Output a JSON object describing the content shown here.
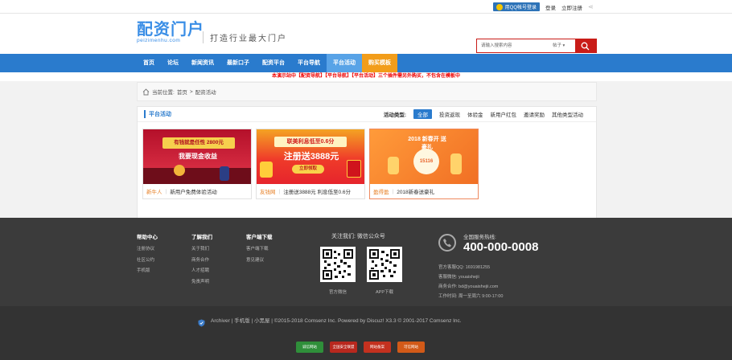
{
  "topbar": {
    "qq_login": "用QQ帐号登录",
    "login": "登录",
    "register": "立即注册"
  },
  "logo": {
    "cn": "配资门户",
    "en": "peizimenhu.com"
  },
  "slogan": "打造行业最大门户",
  "search": {
    "placeholder": "请输入搜索内容",
    "scope": "帖子 ▾"
  },
  "nav": [
    {
      "label": "首页"
    },
    {
      "label": "论坛"
    },
    {
      "label": "新闻资讯"
    },
    {
      "label": "最新口子"
    },
    {
      "label": "配资平台"
    },
    {
      "label": "平台导航"
    },
    {
      "label": "平台活动"
    },
    {
      "label": "购买模板"
    }
  ],
  "notice": "本演示站中【配资导航】【平台导航】【平台活动】三个插件需另外购买，不包含在模板中",
  "breadcrumb": {
    "prefix": "当前位置:",
    "home": "首页",
    "sep": ">",
    "current": "配资活动"
  },
  "panel": {
    "title": "平台活动",
    "filter_label": "活动类型:",
    "filters": [
      "全部",
      "投资返现",
      "体验金",
      "新用户红包",
      "邀请奖励",
      "其他类型活动"
    ]
  },
  "cards": [
    {
      "tag": "新牛人",
      "title": "新用户免费体验活动",
      "banner_line1": "有钱就是任性 2800元",
      "banner_line2": "我要现金收益",
      "color": "#c81b2f"
    },
    {
      "tag": "友钱网",
      "title": "注册送3888元 利息低至0.6分",
      "banner_line1": "联美利息低至0.6分",
      "banner_line2": "注册送3888元",
      "banner_button": "立即领取",
      "color": "#f2432c"
    },
    {
      "tag": "盈得盈",
      "title": "2018新春送豪礼",
      "banner_line1": "2018 新春开 送豪礼",
      "banner_line2": "15116",
      "color": "#f78a2b"
    }
  ],
  "footer": {
    "cols": [
      {
        "title": "帮助中心",
        "items": [
          "注册协议",
          "社区公约",
          "手机版"
        ]
      },
      {
        "title": "了解我们",
        "items": [
          "关于我们",
          "商务合作",
          "人才招聘",
          "免责声明"
        ]
      },
      {
        "title": "客户端下载",
        "items": [
          "客户端下载",
          "意见建议"
        ]
      }
    ],
    "follow": "关注我们:  微信公众号",
    "qr_labels": [
      "官方微信",
      "APP下载"
    ],
    "hotline_label": "全国服务热线:",
    "hotline": "400-000-0008",
    "contacts": [
      "官方客服QQ:  1691981255",
      "客服微信:  youaishejii",
      "商务合作:  bd@youaishejii.com",
      "工作时间:  周一至周六 9:00-17:00"
    ]
  },
  "bottom": {
    "copyright": "Archiver  |  手机版  |  小黑屋   |     ©2015-2018   Comsenz Inc.   Powered by Discuz!   X3.3 © 2001-2017 Comsenz Inc.",
    "badges": [
      "诚信网站",
      "全国安全联盟",
      "网站备案",
      "可信网站"
    ]
  },
  "colors": {
    "brand": "#2a7bcd",
    "search": "#c91c18",
    "accent": "#f29d1a"
  }
}
